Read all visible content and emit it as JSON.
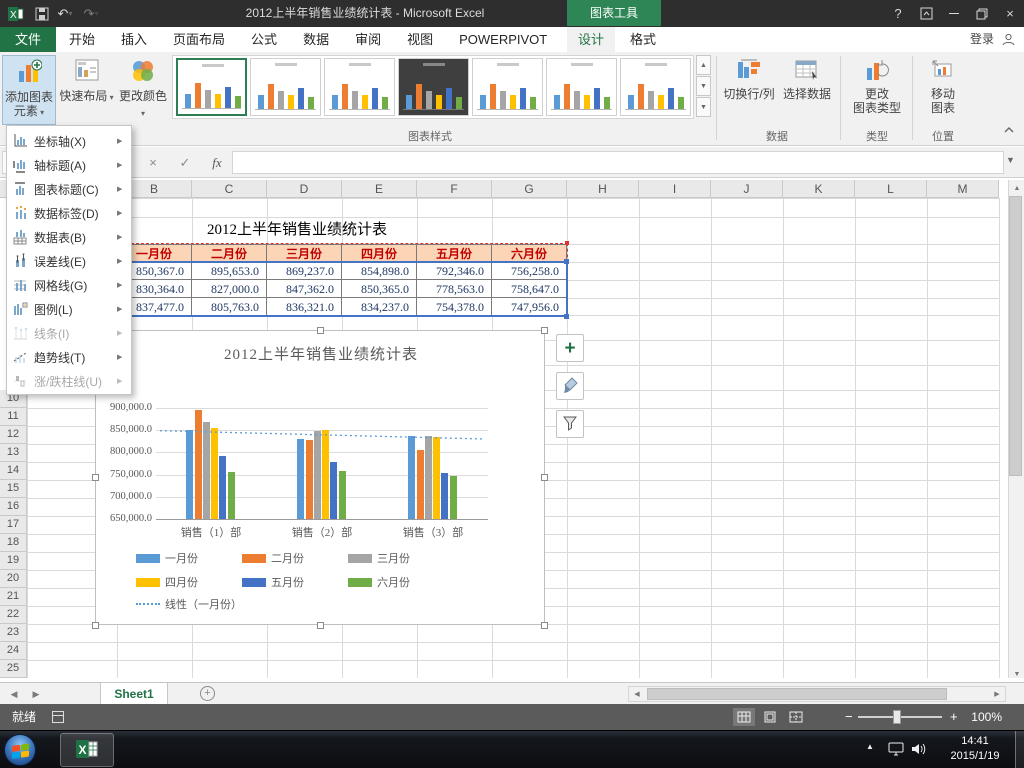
{
  "window": {
    "title": "2012上半年销售业绩统计表 - Microsoft Excel",
    "contextual_tool": "图表工具"
  },
  "tabs": {
    "file": "文件",
    "main": [
      "开始",
      "插入",
      "页面布局",
      "公式",
      "数据",
      "审阅",
      "视图",
      "POWERPIVOT"
    ],
    "contextual": [
      "设计",
      "格式"
    ],
    "active": "设计",
    "signin": "登录"
  },
  "ribbon": {
    "add_chart_element": {
      "l1": "添加图表",
      "l2": "元素"
    },
    "quick_layout": "快速布局",
    "change_colors": "更改颜色",
    "switch_row_col": "切换行/列",
    "select_data": "选择数据",
    "change_chart_type": {
      "l1": "更改",
      "l2": "图表类型"
    },
    "move_chart": {
      "l1": "移动",
      "l2": "图表"
    },
    "group_labels": {
      "styles": "图表样式",
      "data": "数据",
      "type": "类型",
      "location": "位置"
    },
    "gallery": {
      "count": 7,
      "selected": 0,
      "dark_index": 3
    }
  },
  "menu": {
    "items": [
      {
        "label": "坐标轴(X)",
        "icon": "axes-icon",
        "enabled": true
      },
      {
        "label": "轴标题(A)",
        "icon": "axis-titles-icon",
        "enabled": true
      },
      {
        "label": "图表标题(C)",
        "icon": "chart-title-icon",
        "enabled": true
      },
      {
        "label": "数据标签(D)",
        "icon": "data-labels-icon",
        "enabled": true
      },
      {
        "label": "数据表(B)",
        "icon": "data-table-icon",
        "enabled": true
      },
      {
        "label": "误差线(E)",
        "icon": "error-bars-icon",
        "enabled": true
      },
      {
        "label": "网格线(G)",
        "icon": "gridlines-icon",
        "enabled": true
      },
      {
        "label": "图例(L)",
        "icon": "legend-icon",
        "enabled": true
      },
      {
        "label": "线条(I)",
        "icon": "lines-icon",
        "enabled": false
      },
      {
        "label": "趋势线(T)",
        "icon": "trendline-icon",
        "enabled": true
      },
      {
        "label": "涨/跌柱线(U)",
        "icon": "updown-bars-icon",
        "enabled": false
      }
    ]
  },
  "formula_bar": {
    "name_box": "",
    "fx_label": "fx",
    "formula": ""
  },
  "sheet": {
    "columns": [
      "B",
      "C",
      "D",
      "E",
      "F",
      "G",
      "H",
      "I",
      "J",
      "K",
      "L",
      "M"
    ],
    "visible_rows": [
      10,
      11,
      12,
      13,
      14,
      15,
      16,
      17,
      18,
      19,
      20,
      21,
      22,
      23,
      24,
      25
    ],
    "table": {
      "title": "2012上半年销售业绩统计表",
      "month_headers": [
        "一月份",
        "二月份",
        "三月份",
        "四月份",
        "五月份",
        "六月份"
      ],
      "rows": [
        [
          "850,367.0",
          "895,653.0",
          "869,237.0",
          "854,898.0",
          "792,346.0",
          "756,258.0"
        ],
        [
          "830,364.0",
          "827,000.0",
          "847,362.0",
          "850,365.0",
          "778,563.0",
          "758,647.0"
        ],
        [
          "837,477.0",
          "805,763.0",
          "836,321.0",
          "834,237.0",
          "754,378.0",
          "747,956.0"
        ]
      ]
    }
  },
  "chart_data": {
    "type": "bar",
    "title": "2012上半年销售业绩统计表",
    "categories": [
      "销售（1）部",
      "销售（2）部",
      "销售（3）部"
    ],
    "series": [
      {
        "name": "一月份",
        "color": "#5B9BD5",
        "values": [
          850367,
          830364,
          837477
        ]
      },
      {
        "name": "二月份",
        "color": "#ED7D31",
        "values": [
          895653,
          827000,
          805763
        ]
      },
      {
        "name": "三月份",
        "color": "#A5A5A5",
        "values": [
          869237,
          847362,
          836321
        ]
      },
      {
        "name": "四月份",
        "color": "#FFC000",
        "values": [
          854898,
          850365,
          834237
        ]
      },
      {
        "name": "五月份",
        "color": "#4472C4",
        "values": [
          792346,
          778563,
          754378
        ]
      },
      {
        "name": "六月份",
        "color": "#70AD47",
        "values": [
          756258,
          758647,
          747956
        ]
      }
    ],
    "trendline": {
      "name": "线性（一月份）",
      "series": "一月份",
      "color": "#5B9BD5",
      "style": "dotted"
    },
    "y_axis": {
      "min": 650000,
      "max": 900000,
      "step": 50000,
      "tick_labels": [
        "900,000.0",
        "850,000.0",
        "800,000.0",
        "750,000.0",
        "700,000.0",
        "650,000.0"
      ]
    },
    "legend_position": "bottom",
    "gridlines": true
  },
  "sheet_tabs": {
    "active": "Sheet1"
  },
  "status_bar": {
    "mode": "就绪",
    "zoom": "100%"
  },
  "taskbar": {
    "clock": {
      "time": "14:41",
      "date": "2015/1/19"
    }
  }
}
